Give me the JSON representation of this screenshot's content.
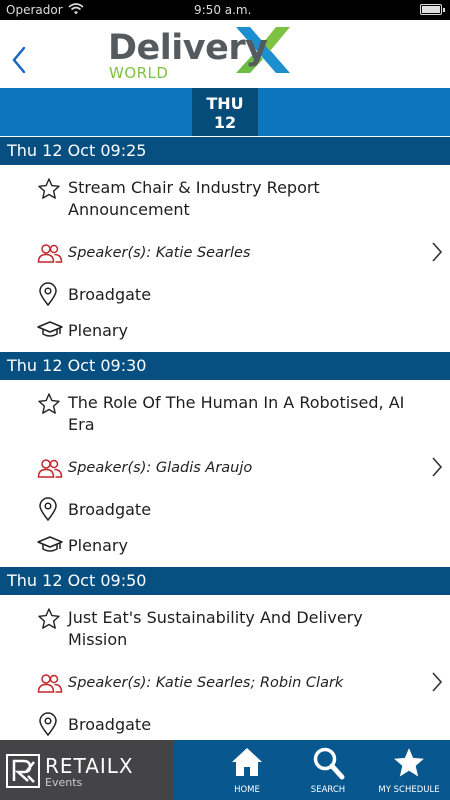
{
  "status_bar": {
    "carrier": "Operador",
    "time": "9:50 a.m."
  },
  "header": {
    "logo_title": "Delivery",
    "logo_subtitle": "WORLD"
  },
  "day_tabs": [
    {
      "day": "THU",
      "date": "12"
    }
  ],
  "sessions": [
    {
      "header": "Thu 12 Oct 09:25",
      "title": "Stream Chair & Industry Report Announcement",
      "speakers": "Speaker(s): Katie Searles",
      "location": "Broadgate",
      "type": "Plenary"
    },
    {
      "header": "Thu 12 Oct 09:30",
      "title": "The Role Of The Human In A Robotised, AI Era",
      "speakers": "Speaker(s): Gladis Araujo",
      "location": "Broadgate",
      "type": "Plenary"
    },
    {
      "header": "Thu 12 Oct 09:50",
      "title": "Just Eat's Sustainability And Delivery Mission",
      "speakers": "Speaker(s): Katie Searles; Robin Clark",
      "location": "Broadgate"
    }
  ],
  "brand": {
    "name": "RETAILX",
    "sub": "Events"
  },
  "nav": [
    {
      "label": "HOME",
      "icon": "home-icon"
    },
    {
      "label": "SEARCH",
      "icon": "search-icon"
    },
    {
      "label": "MY SCHEDULE",
      "icon": "star-icon"
    }
  ],
  "colors": {
    "accent_blue": "#0d75bc",
    "dark_blue": "#074f80",
    "speaker_red": "#c0282d",
    "logo_green": "#7dc242"
  }
}
